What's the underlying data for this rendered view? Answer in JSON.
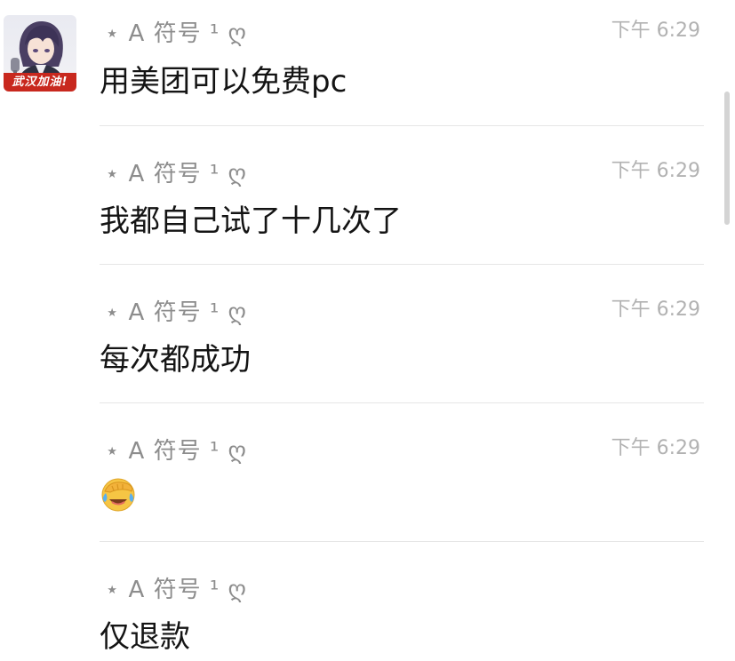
{
  "avatar": {
    "banner_text": "武汉加油!"
  },
  "messages": [
    {
      "sender": "⋆  A 符号 ¹ ღ",
      "time": "下午 6:29",
      "text": "用美团可以免费pc"
    },
    {
      "sender": "⋆  A 符号 ¹ ღ",
      "time": "下午 6:29",
      "text": "我都自己试了十几次了"
    },
    {
      "sender": "⋆  A 符号 ¹ ღ",
      "time": "下午 6:29",
      "text": "每次都成功"
    },
    {
      "sender": "⋆  A 符号 ¹ ღ",
      "time": "下午 6:29",
      "text": "",
      "emoji": "face-with-hand-over-face-crying-laughing"
    },
    {
      "sender": "⋆  A 符号 ¹ ღ",
      "time": "",
      "text": "仅退款"
    }
  ],
  "colors": {
    "sender": "#8d8d8d",
    "time": "#b2b2b2",
    "body": "#141414",
    "divider": "#e6e6e6",
    "banner": "#c8281e"
  }
}
